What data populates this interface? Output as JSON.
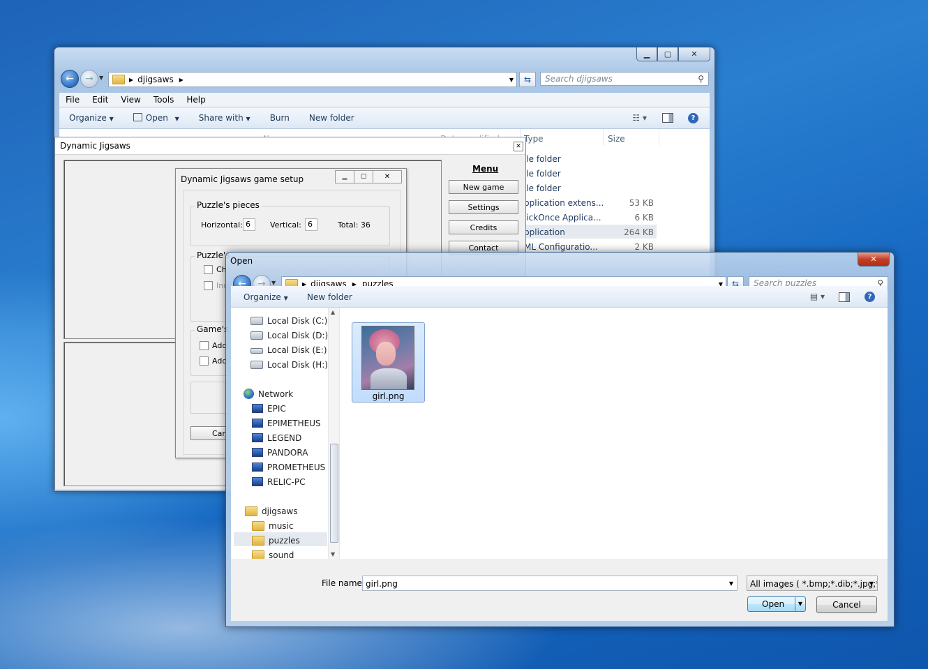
{
  "explorer": {
    "address_folder": "djigsaws",
    "search_placeholder": "Search djigsaws",
    "menu": [
      "File",
      "Edit",
      "View",
      "Tools",
      "Help"
    ],
    "cmd": {
      "organize": "Organize",
      "open": "Open",
      "share": "Share with",
      "burn": "Burn",
      "new_folder": "New folder"
    },
    "columns": {
      "name": "Name",
      "date": "Date modified",
      "type": "Type",
      "size": "Size"
    },
    "rows": [
      {
        "type": "ile folder",
        "size": ""
      },
      {
        "type": "ile folder",
        "size": ""
      },
      {
        "type": "ile folder",
        "size": ""
      },
      {
        "type": "pplication extens...",
        "size": "53 KB"
      },
      {
        "type": "lickOnce Applica...",
        "size": "6 KB"
      },
      {
        "type": "pplication",
        "size": "264 KB"
      },
      {
        "type": "ML Configuratio...",
        "size": "2 KB"
      }
    ]
  },
  "dj": {
    "title": "Dynamic Jigsaws",
    "menu_title": "Menu",
    "buttons": [
      "New game",
      "Settings",
      "Credits",
      "Contact"
    ]
  },
  "setup": {
    "title": "Dynamic Jigsaws game setup",
    "pieces_label": "Puzzle's pieces",
    "horizontal_label": "Horizontal:",
    "horizontal_value": "6",
    "vertical_label": "Vertical:",
    "vertical_value": "6",
    "total": "Total: 36",
    "picture_label": "Puzzle's",
    "chk1": "Ch",
    "chk2": "Inc",
    "games_label": "Game's",
    "chk3": "Add",
    "chk4": "Add",
    "cancel": "Car"
  },
  "open": {
    "title": "Open",
    "breadcrumb": [
      "djigsaws",
      "puzzles"
    ],
    "search_placeholder": "Search puzzles",
    "organize": "Organize",
    "new_folder": "New folder",
    "nav": {
      "drives": [
        "Local Disk (C:)",
        "Local Disk (D:)",
        "Local Disk (E:)",
        "Local Disk (H:)"
      ],
      "network": "Network",
      "computers": [
        "EPIC",
        "EPIMETHEUS",
        "LEGEND",
        "PANDORA",
        "PROMETHEUS",
        "RELIC-PC"
      ],
      "folder": "djigsaws",
      "subfolders": [
        "music",
        "puzzles",
        "sound"
      ]
    },
    "file": {
      "name": "girl.png"
    },
    "filename_label": "File name:",
    "filename_value": "girl.png",
    "filter": "All images  ( *.bmp;*.dib;*.jpg;*",
    "open_btn": "Open",
    "cancel_btn": "Cancel"
  }
}
